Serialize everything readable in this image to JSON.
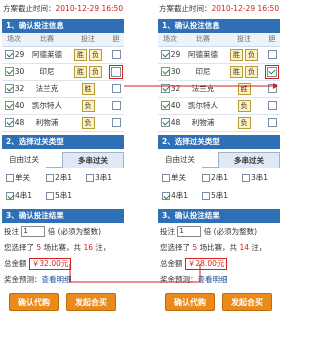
{
  "left": {
    "deadline_label": "方案截止时间：",
    "deadline_value": "2010-12-29 16:50",
    "sec1": "1、确认投注信息",
    "headers": [
      "场次",
      "比赛",
      "投注",
      "胆"
    ],
    "matches": [
      {
        "idx": "29",
        "team": "阿德莱德",
        "bets": [
          "胜",
          "负"
        ]
      },
      {
        "idx": "30",
        "team": "印尼",
        "bets": [
          "胜",
          "负"
        ]
      },
      {
        "idx": "32",
        "team": "法兰克",
        "bets": [
          "胜"
        ]
      },
      {
        "idx": "40",
        "team": "凯尔特人",
        "bets": [
          "负"
        ]
      },
      {
        "idx": "48",
        "team": "利物浦",
        "bets": [
          "负"
        ]
      }
    ],
    "sec2": "2、选择过关类型",
    "tab_free": "自由过关",
    "tab_multi": "多串过关",
    "opts": [
      "单关",
      "2串1",
      "3串1",
      "4串1",
      "5串1"
    ],
    "sec3": "3、确认投注结果",
    "bet_label": "投注",
    "bet_value": "1",
    "bet_suffix": "倍 (必须为整数)",
    "summary_1": "您选择了",
    "summary_matches": "5",
    "summary_2": "场比赛，共",
    "summary_bets": "16",
    "summary_3": "注，",
    "total_label": "总金额",
    "total_value": "￥32.00元",
    "prize_label": "奖金预测：",
    "prize_link": "查看明细",
    "btn_confirm": "确认代购",
    "btn_group": "发起合买"
  },
  "right": {
    "deadline_label": "方案截止时间：",
    "deadline_value": "2010-12-29 16:50",
    "sec1": "1、确认投注信息",
    "headers": [
      "场次",
      "比赛",
      "投注",
      "胆"
    ],
    "matches": [
      {
        "idx": "29",
        "team": "阿德莱德",
        "bets": [
          "胜",
          "负"
        ]
      },
      {
        "idx": "30",
        "team": "印尼",
        "bets": [
          "胜",
          "负"
        ]
      },
      {
        "idx": "32",
        "team": "法兰克",
        "bets": [
          "胜"
        ]
      },
      {
        "idx": "40",
        "team": "凯尔特人",
        "bets": [
          "负"
        ]
      },
      {
        "idx": "48",
        "team": "利物浦",
        "bets": [
          "负"
        ]
      }
    ],
    "sec2": "2、选择过关类型",
    "tab_free": "自由过关",
    "tab_multi": "多串过关",
    "opts": [
      "单关",
      "2串1",
      "3串1",
      "4串1",
      "5串1"
    ],
    "sec3": "3、确认投注结果",
    "bet_label": "投注",
    "bet_value": "1",
    "bet_suffix": "倍 (必须为整数)",
    "summary_1": "您选择了",
    "summary_matches": "5",
    "summary_2": "场比赛，共",
    "summary_bets": "14",
    "summary_3": "注，",
    "total_label": "总金额",
    "total_value": "￥28.00元",
    "prize_label": "奖金预测：",
    "prize_link": "查看明细",
    "btn_confirm": "确认代购",
    "btn_group": "发起合买"
  },
  "colors": {
    "section_bg": "#2f6fb6",
    "accent_red": "#d2221b",
    "button_orange": "#ea8a1a",
    "pill_bg": "#fff2c2"
  }
}
